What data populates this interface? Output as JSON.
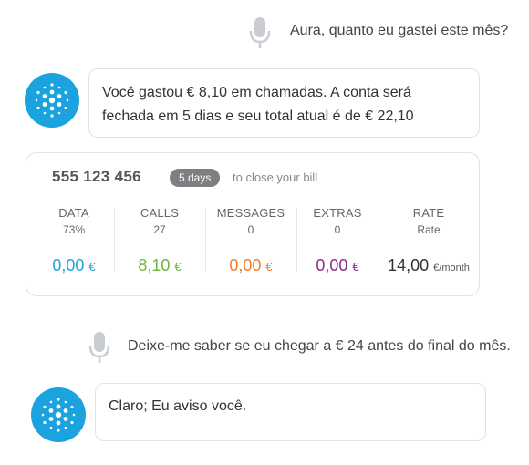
{
  "conversation": {
    "user_message_1": "Aura, quanto eu gastei este mês?",
    "assistant_message_1": {
      "line1": "Você gastou € 8,10 em chamadas. A conta será",
      "line2": "fechada em 5 dias e seu total atual é de € 22,10"
    },
    "user_message_2": "Deixe-me saber se eu chegar a € 24 antes do final do mês.",
    "assistant_message_2": "Claro; Eu aviso você."
  },
  "bill_card": {
    "phone_number": "555 123 456",
    "days_badge": "5 days",
    "close_text": "to close your bill",
    "columns": [
      {
        "label": "DATA",
        "sub": "73%",
        "value": "0,00",
        "currency": "€",
        "color": "#1aa3df"
      },
      {
        "label": "CALLS",
        "sub": "27",
        "value": "8,10",
        "currency": "€",
        "color": "#6cb33f"
      },
      {
        "label": "MESSAGES",
        "sub": "0",
        "value": "0,00",
        "currency": "€",
        "color": "#f07d28"
      },
      {
        "label": "EXTRAS",
        "sub": "0",
        "value": "0,00",
        "currency": "€",
        "color": "#8e2a8e"
      },
      {
        "label": "RATE",
        "sub": "Rate",
        "value": "14,00",
        "currency": "€/month",
        "color": "#333333"
      }
    ]
  },
  "icons": {
    "mic": "microphone-icon",
    "assistant": "aura-logo-icon"
  },
  "colors": {
    "accent": "#1aa3df",
    "mic": "#c9cdd1",
    "border": "#dfe3e6"
  }
}
